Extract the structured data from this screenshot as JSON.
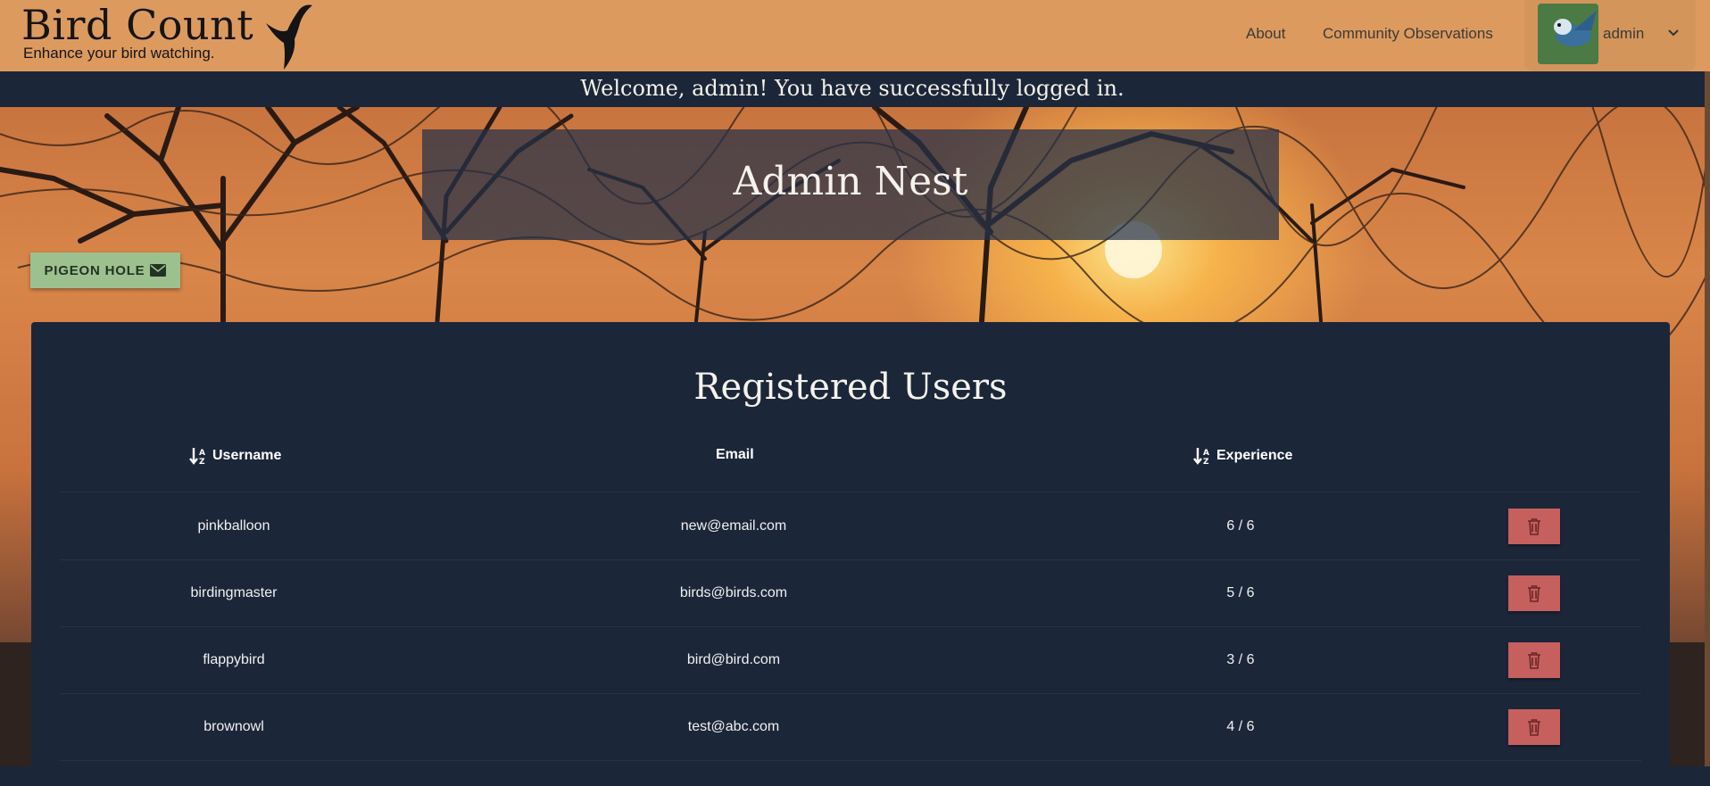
{
  "header": {
    "brand_title": "Bird Count",
    "brand_tagline": "Enhance your bird watching.",
    "nav": {
      "about": "About",
      "community": "Community Observations"
    },
    "user": {
      "name": "admin"
    }
  },
  "welcome_message": "Welcome, admin! You have successfully logged in.",
  "page_title": "Admin Nest",
  "pigeon_hole_label": "PIGEON HOLE",
  "users_table": {
    "title": "Registered Users",
    "columns": {
      "username": "Username",
      "email": "Email",
      "experience": "Experience"
    },
    "rows": [
      {
        "username": "pinkballoon",
        "email": "new@email.com",
        "experience": "6 / 6"
      },
      {
        "username": "birdingmaster",
        "email": "birds@birds.com",
        "experience": "5 / 6"
      },
      {
        "username": "flappybird",
        "email": "bird@bird.com",
        "experience": "3 / 6"
      },
      {
        "username": "brownowl",
        "email": "test@abc.com",
        "experience": "4 / 6"
      }
    ]
  },
  "colors": {
    "header_bg": "#dd9a5f",
    "panel_bg": "#1c2639",
    "pigeon_button": "#9dc08f",
    "delete_button": "#c5605e"
  },
  "icons": {
    "brand": "bird-silhouette-icon",
    "user_menu": "chevron-down-icon",
    "pigeon_hole": "envelope-icon",
    "sort": "sort-alpha-icon",
    "delete": "trash-icon"
  }
}
